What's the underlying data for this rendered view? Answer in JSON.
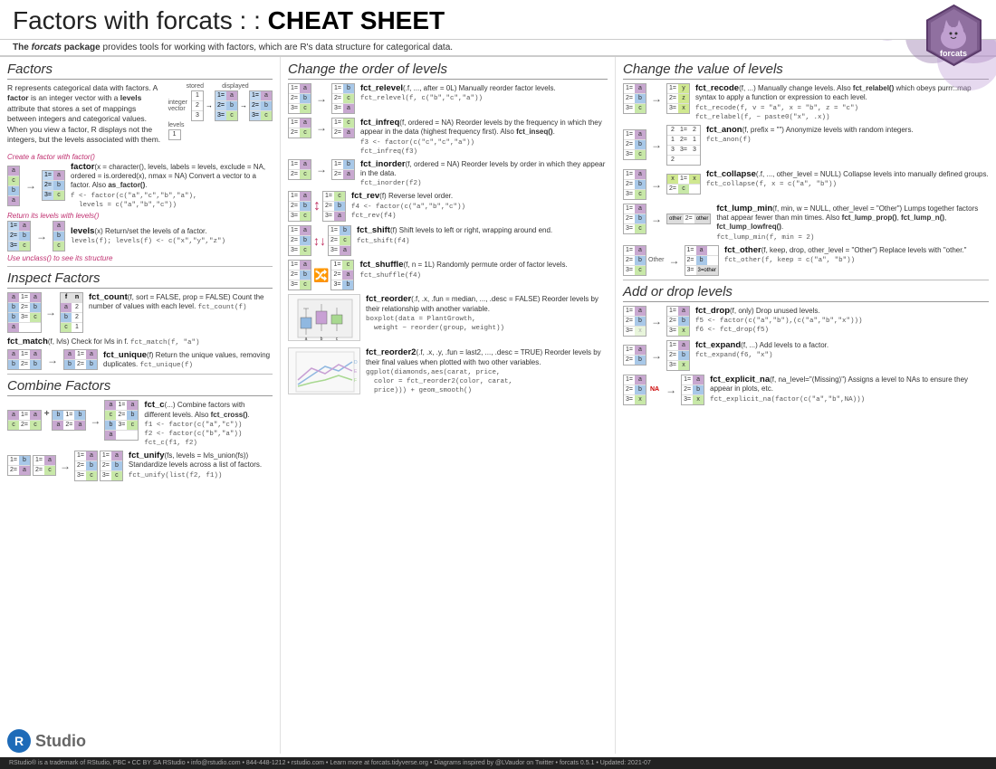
{
  "header": {
    "title_prefix": "Factors with forcats : : ",
    "title_bold": "CHEAT SHEET",
    "subtitle": "The forcats package provides tools for working with factors, which are R's data structure for categorical data."
  },
  "footer": {
    "text": "RStudio® is a trademark of RStudio, PBC  •  CC BY SA  RStudio  •  info@rstudio.com  •  844-448-1212  •  rstudio.com  •  Learn more at forcats.tidyverse.org  •  Diagrams inspired by @LVaudor on Twitter  •  forcats 0.5.1  •  Updated: 2021-07"
  },
  "sections": {
    "factors": {
      "title": "Factors",
      "intro": "R represents categorical data with factors. A factor is an integer vector with a levels attribute that stores a set of mappings between integers and categorical values. When you view a factor, R displays not the integers, but the levels associated with them.",
      "note1": "Create a factor with factor()",
      "factor_fn": "factor(x = character(), levels, labels = levels, exclude = NA, ordered = is.ordered(x), nmax = NA) Convert a vector to a factor. Also as_factor().",
      "factor_code": "f <- factor(c(\"a\", \"c\", \"b\", \"a\"), levels = c(\"a\", \"b\", \"c\"))",
      "note2": "Return its levels with levels()",
      "levels_fn": "levels(x) Return/set the levels of a factor.",
      "levels_code": "levels(f); levels(f) <- c(\"x\",\"y\",\"z\")",
      "note3": "Use unclass() to see its structure"
    },
    "inspect": {
      "title": "Inspect Factors",
      "fns": [
        {
          "name": "fct_count",
          "desc": "fct_count(f, sort = FALSE, prop = FALSE) Count the number of values with each level.",
          "code": "fct_count(f)"
        },
        {
          "name": "fct_match",
          "desc": "fct_match(f, lvls) Check for lvls in f.",
          "code": "fct_match(f, \"a\")"
        },
        {
          "name": "fct_unique",
          "desc": "fct_unique(f) Return the unique values, removing duplicates.",
          "code": "fct_unique(f)"
        }
      ]
    },
    "combine": {
      "title": "Combine Factors",
      "fns": [
        {
          "name": "fct_c",
          "desc": "fct_c(...) Combine factors with different levels. Also fct_cross().",
          "code": "f1 <- factor(c(\"a\", \"c\"))\nf2 <- factor(c(\"b\", \"a\"))\nfct_c(f1, f2)"
        },
        {
          "name": "fct_unify",
          "desc": "fct_unify(fs, levels = lvls_union(fs)) Standardize levels across a list of factors.",
          "code": "fct_unify(list(f2, f1))"
        }
      ]
    },
    "order": {
      "title": "Change the order of levels",
      "fns": [
        {
          "name": "fct_relevel",
          "desc": "fct_relevel(.f, ..., after = 0L) Manually reorder factor levels.",
          "code": "fct_relevel(f, c(\"b\", \"c\", \"a\"))"
        },
        {
          "name": "fct_infreq",
          "desc": "fct_infreq(f, ordered = NA) Reorder levels by the frequency in which they appear in the data (highest frequency first). Also fct_inseq().",
          "code": "f3 <- factor(c(\"c\",\"c\",\"a\"))\nfct_infreq(f3)"
        },
        {
          "name": "fct_inorder",
          "desc": "fct_inorder(f, ordered = NA) Reorder levels by order in which they appear in the data.",
          "code": "fct_inorder(f2)"
        },
        {
          "name": "fct_rev",
          "desc": "fct_rev(f) Reverse level order.",
          "code": "f4 <- factor(c(\"a\",\"b\",\"c\"))\nfct_rev(f4)"
        },
        {
          "name": "fct_shift",
          "desc": "fct_shift(f) Shift levels to left or right, wrapping around end.",
          "code": "fct_shift(f4)"
        },
        {
          "name": "fct_shuffle",
          "desc": "fct_shuffle(f, n = 1L) Randomly permute order of factor levels.",
          "code": "fct_shuffle(f4)"
        },
        {
          "name": "fct_reorder",
          "desc": "fct_reorder(.f, .x, .fun = median, ..., .desc = FALSE) Reorder levels by their relationship with another variable.",
          "code": "boxplot(data = PlantGrowth, weight ~ reorder(group, weight))"
        },
        {
          "name": "fct_reorder2",
          "desc": "fct_reorder2(.f, .x, .y, .fun = last2, ..., .desc = TRUE) Reorder levels by their final values when plotted with two other variables.",
          "code": "ggplot(diamonds,aes(carat, price, color = fct_reorder2(color, carat, price))) + geom_smooth()"
        }
      ]
    },
    "value": {
      "title": "Change the value of levels",
      "fns": [
        {
          "name": "fct_recode",
          "desc": "fct_recode(f, ...) Manually change levels. Also fct_relabel() which obeys purrr::map syntax to apply a function or expression to each level.",
          "code": "fct_recode(f, v = \"a\", x = \"b\", z = \"c\")\nfct_relabel(f, ~ paste0(\"x\", .x))"
        },
        {
          "name": "fct_anon",
          "desc": "fct_anon(f, prefix = \"\") Anonymize levels with random integers.",
          "code": "fct_anon(f)"
        },
        {
          "name": "fct_collapse",
          "desc": "fct_collapse(.f, ..., other_level = NULL) Collapse levels into manually defined groups.",
          "code": "fct_collapse(f, x = c(\"a\", \"b\"))"
        },
        {
          "name": "fct_lump_min",
          "desc": "fct_lump_min(f, min, w = NULL, other_level = \"Other\") Lumps together factors that appear fewer than min times. Also fct_lump_prop(), fct_lump_n(), fct_lump_lowfreq().",
          "code": "fct_lump_min(f, min = 2)"
        },
        {
          "name": "fct_other",
          "desc": "fct_other(f, keep, drop, other_level = \"Other\") Replace levels with \"other.\"",
          "code": "fct_other(f, keep = c(\"a\", \"b\"))"
        }
      ]
    },
    "drop": {
      "title": "Add or drop levels",
      "fns": [
        {
          "name": "fct_drop",
          "desc": "fct_drop(f, only) Drop unused levels.",
          "code": "f5 <- factor(c(\"a\",\"b\"),(c(\"a\",\"b\",\"x\")))\nf6 <- fct_drop(f5)"
        },
        {
          "name": "fct_expand",
          "desc": "fct_expand(f, ...) Add levels to a factor.",
          "code": "fct_expand(f6, \"x\")"
        },
        {
          "name": "fct_explicit_na",
          "desc": "fct_explicit_na(f, na_level=\"(Missing)\") Assigns a level to NAs to ensure they appear in plots, etc.",
          "code": "fct_explicit_na(factor(c(\"a\", \"b\", NA)))"
        }
      ]
    }
  }
}
